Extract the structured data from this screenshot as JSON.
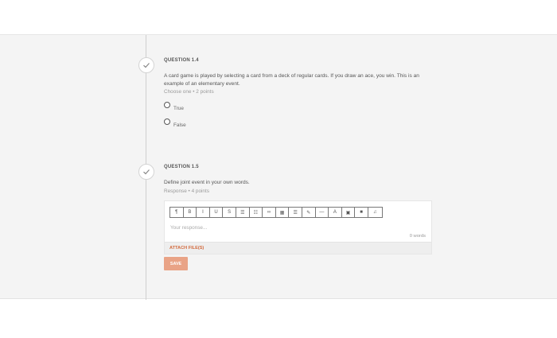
{
  "q14": {
    "title": "QUESTION 1.4",
    "text": "A card game is played by selecting a card from a deck of regular cards. If you draw an ace, you win. This is an example of an elementary event.",
    "meta": "Choose one • 2 points",
    "options": [
      "True",
      "False"
    ]
  },
  "q15": {
    "title": "QUESTION 1.5",
    "text": "Define joint event in your own words.",
    "meta": "Response • 4 points",
    "placeholder": "Your response...",
    "word_count": "0 words",
    "attach_label": "ATTACH FILE(S)",
    "save_label": "SAVE"
  },
  "toolbar": {
    "icons": [
      "paragraph-icon",
      "bold-icon",
      "italic-icon",
      "underline-icon",
      "strikethrough-icon",
      "bullet-list-icon",
      "numbered-list-icon",
      "link-icon",
      "table-icon",
      "align-icon",
      "eraser-icon",
      "horizontal-rule-icon",
      "text-color-icon",
      "image-icon",
      "video-icon",
      "audio-icon"
    ],
    "glyphs": [
      "¶",
      "B",
      "I",
      "U",
      "S",
      "☰",
      "☷",
      "∞",
      "▦",
      "☰",
      "✎",
      "—",
      "A",
      "▣",
      "■",
      "♫"
    ]
  }
}
